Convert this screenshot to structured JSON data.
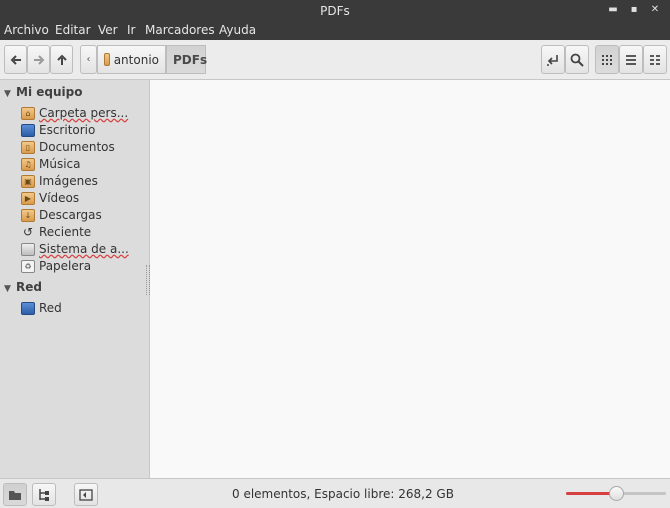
{
  "window": {
    "title": "PDFs"
  },
  "menu": [
    "Archivo",
    "Editar",
    "Ver",
    "Ir",
    "Marcadores",
    "Ayuda"
  ],
  "breadcrumb": {
    "home_label": "antonio",
    "current_label": "PDFs"
  },
  "sidebar": {
    "sections": [
      {
        "label": "Mi equipo",
        "items": [
          {
            "label": "Carpeta pers...",
            "icon": "home-folder-icon"
          },
          {
            "label": "Escritorio",
            "icon": "desktop-icon"
          },
          {
            "label": "Documentos",
            "icon": "documents-folder-icon"
          },
          {
            "label": "Música",
            "icon": "music-folder-icon"
          },
          {
            "label": "Imágenes",
            "icon": "pictures-folder-icon"
          },
          {
            "label": "Vídeos",
            "icon": "videos-folder-icon"
          },
          {
            "label": "Descargas",
            "icon": "downloads-folder-icon"
          },
          {
            "label": "Reciente",
            "icon": "recent-icon"
          },
          {
            "label": "Sistema de a...",
            "icon": "drive-icon"
          },
          {
            "label": "Papelera",
            "icon": "trash-icon"
          }
        ]
      },
      {
        "label": "Red",
        "items": [
          {
            "label": "Red",
            "icon": "network-icon"
          }
        ]
      }
    ]
  },
  "status": {
    "text": "0 elementos, Espacio libre: 268,2 GB",
    "zoom_level": 0.5
  },
  "colors": {
    "accent": "#d64040",
    "titlebar": "#3a3a3a",
    "content_bg": "#f9f9f9"
  }
}
